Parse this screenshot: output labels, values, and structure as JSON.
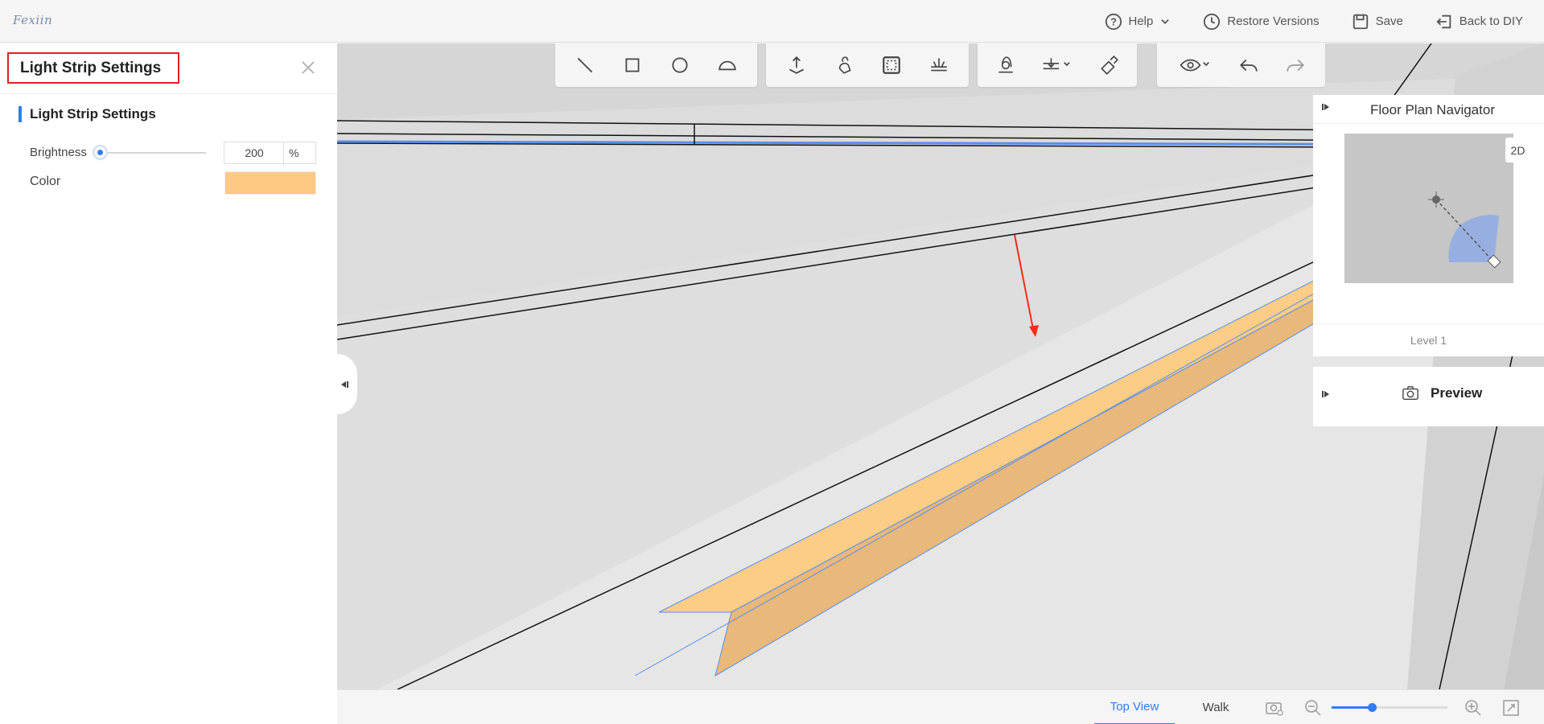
{
  "app": {
    "logo_text": "Fexiin",
    "accent_color": "#2f7cf6"
  },
  "topnav": {
    "help_label": "Help",
    "restore_label": "Restore Versions",
    "save_label": "Save",
    "back_label": "Back to DIY"
  },
  "left_panel": {
    "title": "Light Strip Settings",
    "section_title": "Light Strip Settings",
    "brightness_label": "Brightness",
    "brightness_value": "200",
    "brightness_slider_fraction": 0.0,
    "brightness_unit": "%",
    "color_label": "Color",
    "color_value": "#fdc983"
  },
  "toolbar": {
    "groups": [
      [
        "line-tool-icon",
        "rectangle-tool-icon",
        "circle-tool-icon",
        "arc-tool-icon"
      ],
      [
        "move-tool-icon",
        "hand-tool-icon",
        "select-area-icon",
        "light-effect-icon"
      ],
      [
        "measure-tool-icon",
        "align-dropdown-icon",
        "paint-tool-icon"
      ],
      [
        "view-dropdown-icon",
        "undo-icon",
        "redo-icon"
      ]
    ]
  },
  "navigator": {
    "title": "Floor Plan Navigator",
    "mode_label": "2D",
    "level_label": "Level 1"
  },
  "preview": {
    "label": "Preview"
  },
  "bottom_bar": {
    "tabs": [
      "Top View",
      "Walk"
    ],
    "active_tab": "Top View",
    "zoom_fraction": 0.35
  }
}
